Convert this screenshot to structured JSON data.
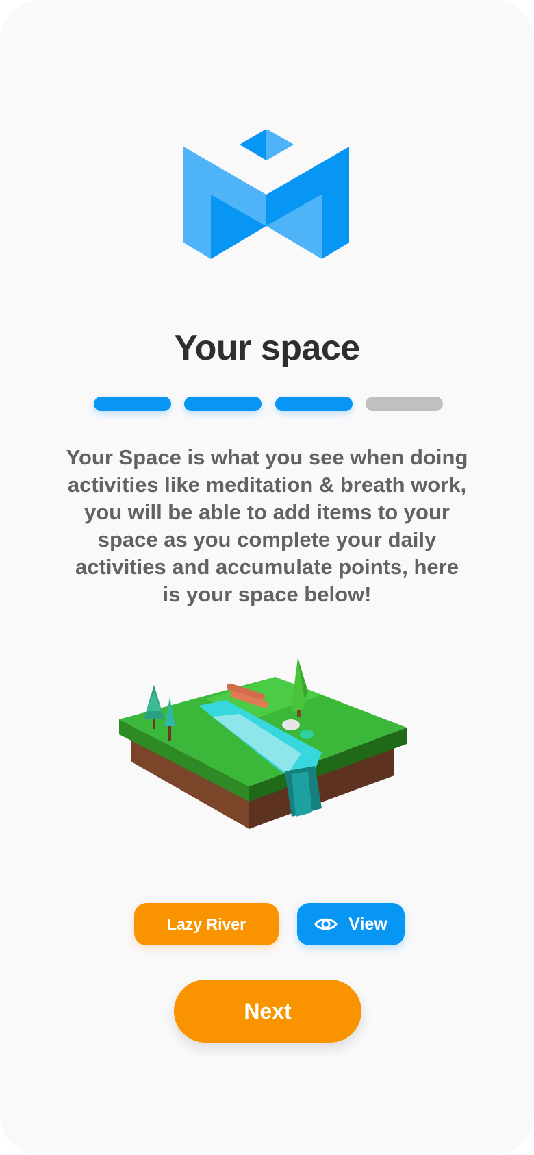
{
  "screen": {
    "title": "Your space",
    "progress": {
      "current_step": 3,
      "total_steps": 4
    },
    "description": "Your Space is what you see when doing activities like meditation & breath work, you will be able to add items to your space as you complete your daily activities and accumulate points, here is your space below!",
    "space_preview": {
      "scene": "lazy-river-island"
    },
    "space_name_button": {
      "label": "Lazy River"
    },
    "view_button": {
      "label": "View",
      "icon": "eye-icon"
    },
    "next_button": {
      "label": "Next"
    }
  },
  "colors": {
    "primary_blue": "#0896f5",
    "light_blue": "#4fb4f7",
    "orange": "#f99400",
    "inactive": "#c0c0c0",
    "title_text": "#2e2e2e",
    "body_text": "#626262",
    "background": "#f9f9fa"
  }
}
